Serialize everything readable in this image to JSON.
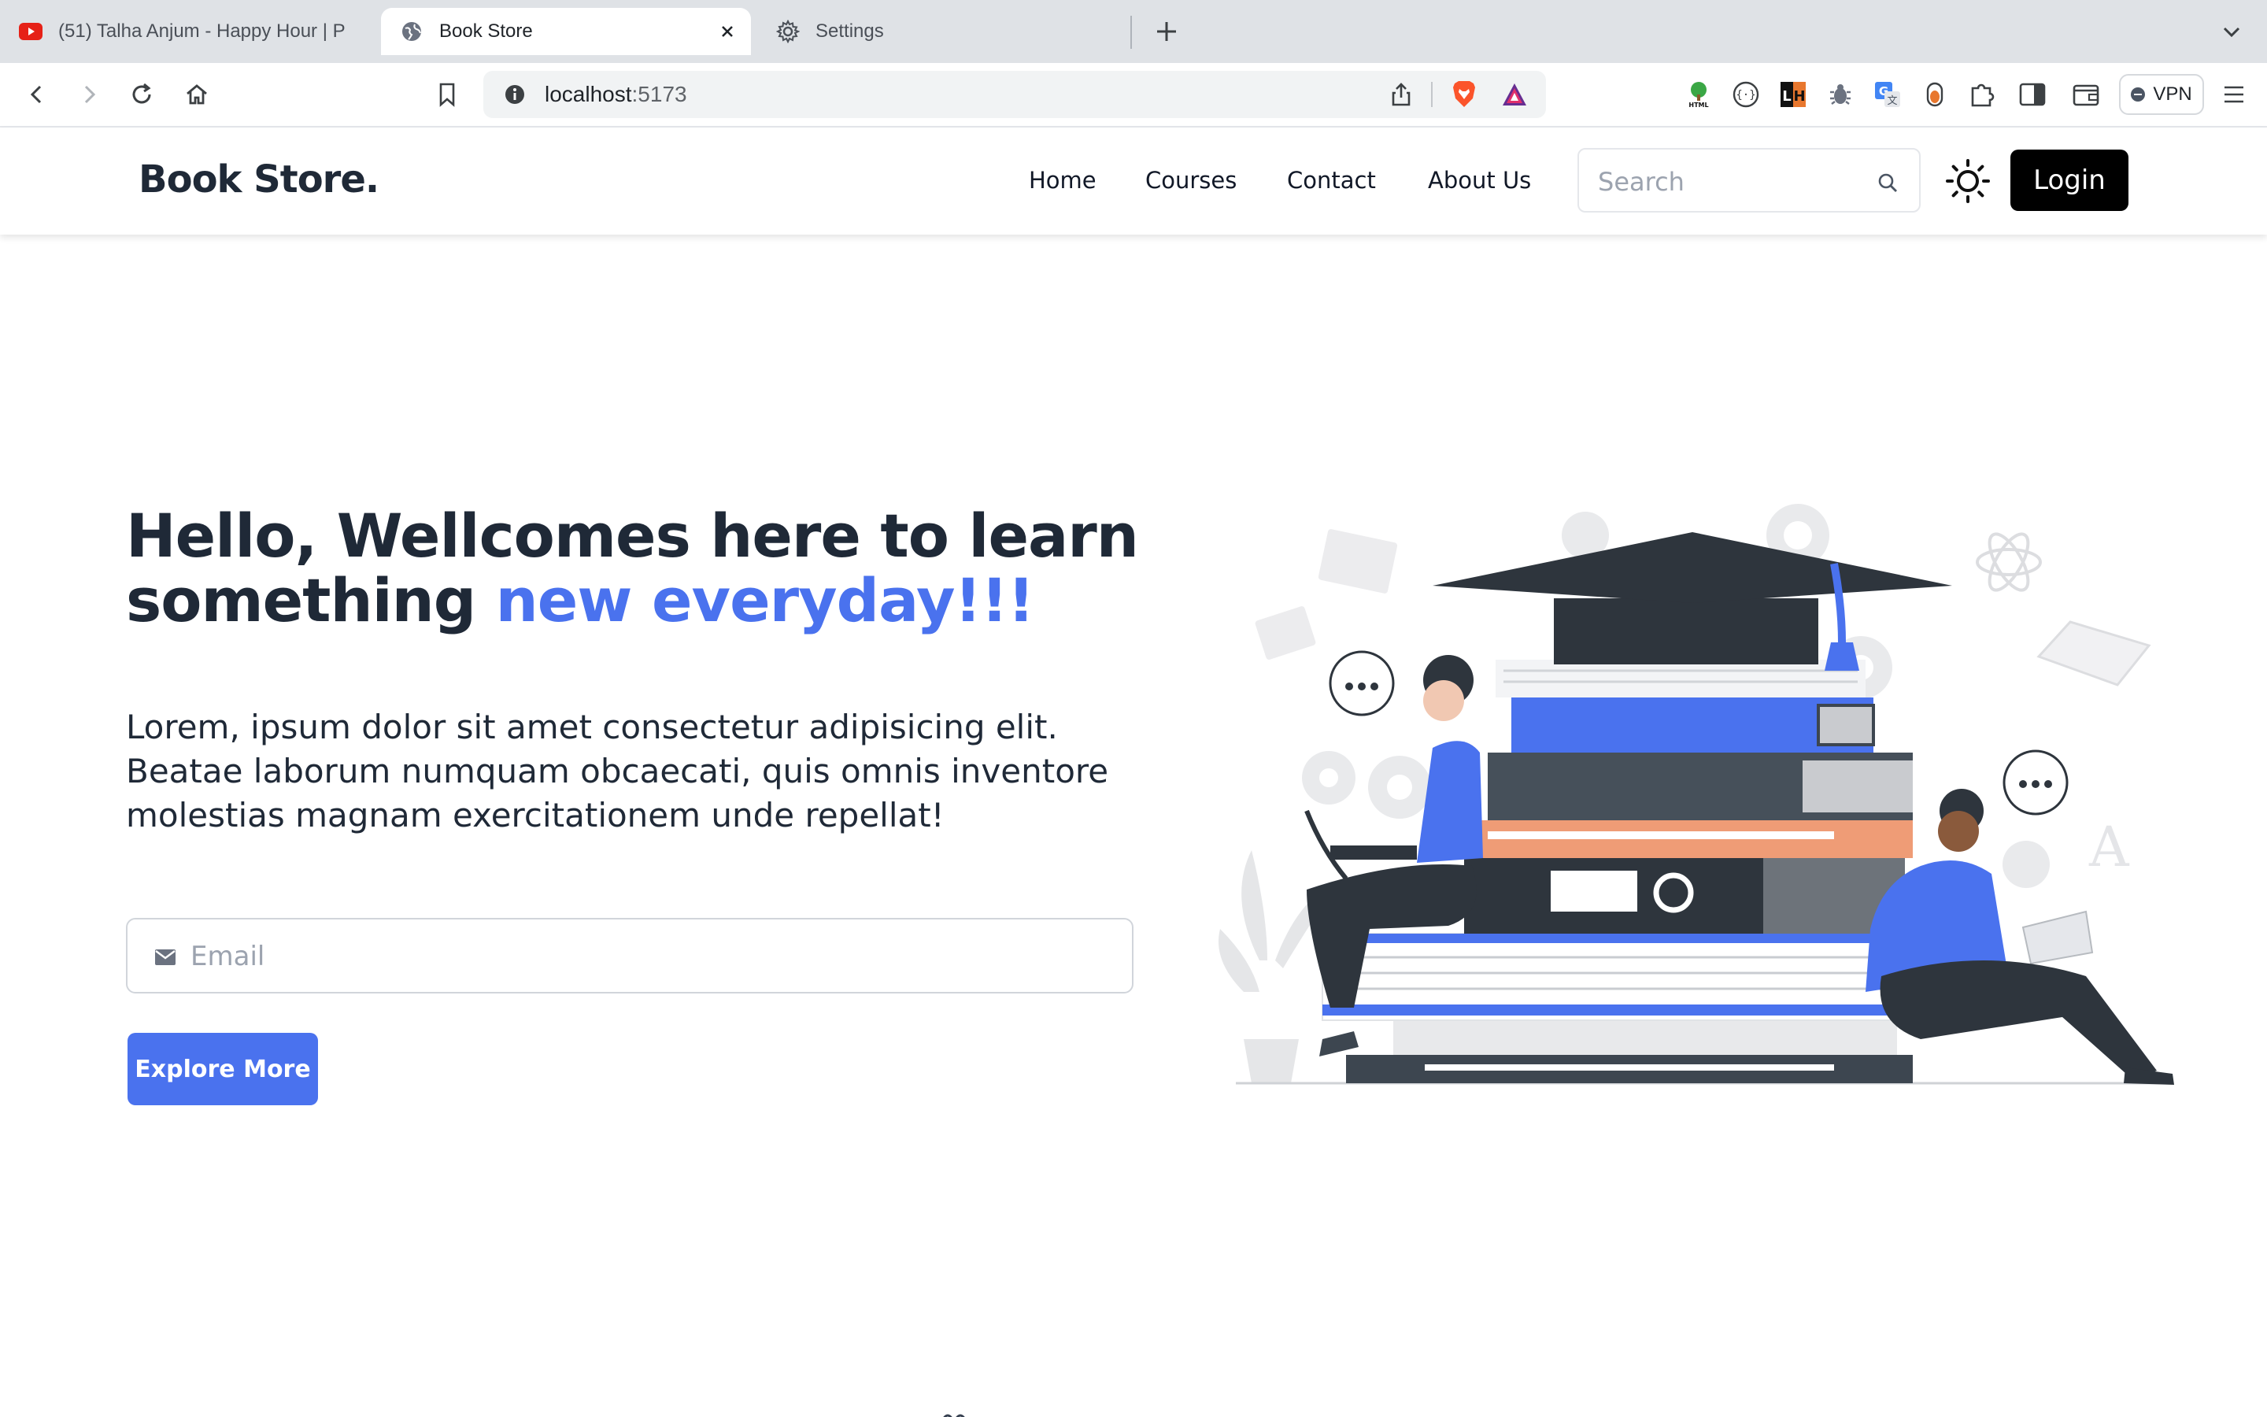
{
  "browser": {
    "tabs": [
      {
        "title": "(51) Talha Anjum - Happy Hour | P",
        "icon": "youtube-icon",
        "active": false
      },
      {
        "title": "Book Store",
        "icon": "globe-icon",
        "active": true
      },
      {
        "title": "Settings",
        "icon": "gear-icon",
        "active": false
      }
    ],
    "url": {
      "host": "localhost",
      "port": ":5173"
    },
    "vpn_label": "VPN",
    "extensions": [
      "html-tree-icon",
      "code-braces-icon",
      "lh-icon",
      "bug-icon",
      "translate-icon",
      "shield-ext-icon",
      "puzzle-icon",
      "sidebar-icon",
      "wallet-icon"
    ],
    "colors": {
      "tabbar": "#dfe2e6",
      "brave_orange": "#fb542b"
    }
  },
  "navbar": {
    "brand": "Book Store.",
    "links": [
      "Home",
      "Courses",
      "Contact",
      "About Us"
    ],
    "search_placeholder": "Search",
    "login_label": "Login"
  },
  "hero": {
    "title_prefix": "Hello, Wellcomes here to learn something",
    "title_accent": "new everyday!!!",
    "body": "Lorem, ipsum dolor sit amet consectetur adipisicing elit. Beatae laborum numquam obcaecati, quis omnis inventore molestias magnam exercitationem unde repellat!",
    "email_placeholder": "Email",
    "button_label": "Explore More",
    "accent_color": "#4a72ee"
  }
}
